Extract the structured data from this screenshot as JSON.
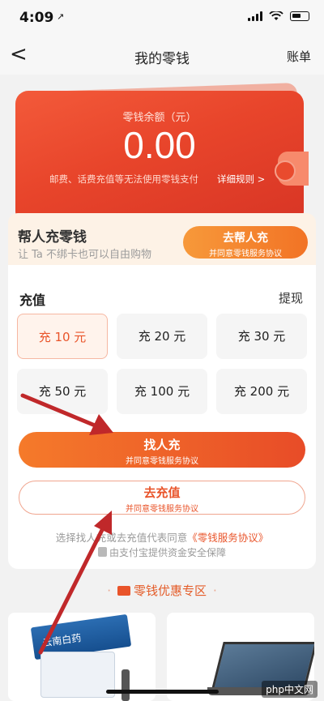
{
  "status": {
    "time": "4:09",
    "location_glyph": "↗"
  },
  "nav": {
    "back": "<",
    "title": "我的零钱",
    "right": "账单"
  },
  "wallet": {
    "label": "零钱余额（元）",
    "amount": "0.00",
    "note": "邮费、话费充值等无法使用零钱支付",
    "rule": "详细规则 >"
  },
  "help": {
    "title": "帮人充零钱",
    "subtitle": "让 Ta 不绑卡也可以自由购物",
    "button": "去帮人充",
    "button_sub": "并同意零钱服务协议"
  },
  "recharge": {
    "title": "充值",
    "withdraw": "提现",
    "amounts": [
      "充 10 元",
      "充 20 元",
      "充 30 元",
      "充 50 元",
      "充 100 元",
      "充 200 元"
    ],
    "selected_index": 0,
    "primary": {
      "label": "找人充",
      "sub": "并同意零钱服务协议"
    },
    "secondary": {
      "label": "去充值",
      "sub": "并同意零钱服务协议"
    },
    "agreement_prefix": "选择找人充或去充值代表同意",
    "agreement_link": "《零钱服务协议》",
    "safety": "由支付宝提供资金安全保障"
  },
  "promo": {
    "title": "零钱优惠专区",
    "product1_text": "云南白药",
    "watermark": "php中文网"
  },
  "colors": {
    "accent": "#e9542a",
    "wallet_red": "#e8452b",
    "arrow": "#c0282a"
  }
}
